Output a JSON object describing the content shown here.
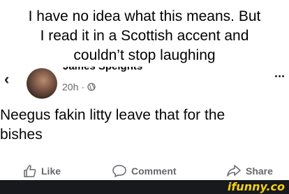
{
  "caption": {
    "lines": [
      "I have no idea what this means. But",
      "I read it in a Scottish accent and",
      "couldn’t stop laughing"
    ]
  },
  "post_header": {
    "author": "James Speights",
    "time": "20h",
    "separator": "·",
    "more_label": "···",
    "back_label": "‹"
  },
  "post": {
    "text_line1": "Neegus fakin litty leave that for the",
    "text_line2": "bishes"
  },
  "actions": {
    "like": "Like",
    "comment": "Comment",
    "share": "Share"
  },
  "footer": {
    "brand": "ifunny.co"
  },
  "colors": {
    "secondary_text": "#65676b",
    "brand_yellow": "#f5d20f",
    "footer_bg": "#17191c"
  }
}
